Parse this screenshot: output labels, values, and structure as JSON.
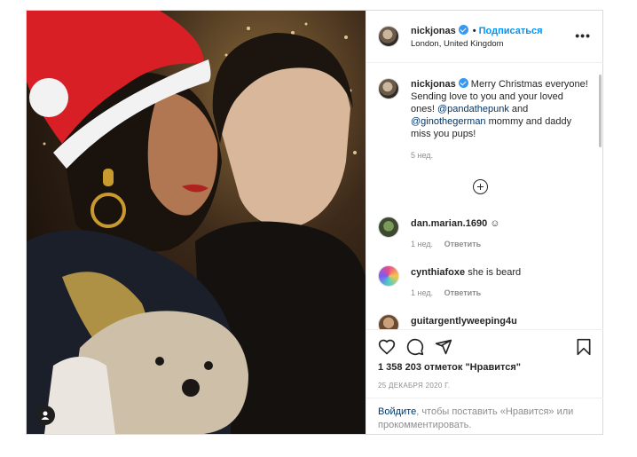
{
  "post": {
    "username": "nickjonas",
    "separator": "•",
    "follow_label": "Подписаться",
    "location": "London, United Kingdom",
    "more_label": "•••"
  },
  "caption": {
    "username": "nickjonas",
    "text_before": " Merry Christmas everyone! Sending love to you and your loved ones! ",
    "mention1": "@pandathepunk",
    "text_mid": " and ",
    "mention2": "@ginothegerman",
    "text_after": " mommy and daddy miss you pups!",
    "time": "5 нед."
  },
  "comments": [
    {
      "username": "dan.marian.1690",
      "text": "☺",
      "time": "1 нед.",
      "reply": "Ответить"
    },
    {
      "username": "cynthiafoxe",
      "text": "she is beard",
      "time": "1 нед.",
      "reply": "Ответить"
    },
    {
      "username": "guitargentlyweeping4u",
      "text": "",
      "time": "",
      "reply": ""
    }
  ],
  "stats": {
    "likes": "1 358 203 отметок \"Нравится\"",
    "date": "25 ДЕКАБРЯ 2020 Г."
  },
  "login_prompt": {
    "link": "Войдите",
    "text": ", чтобы поставить «Нравится» или прокомментировать."
  },
  "icons": [
    "heart-icon",
    "comment-icon",
    "share-icon",
    "bookmark-icon",
    "plus-circle-icon",
    "user-tag-icon",
    "verified-badge-icon"
  ],
  "colors": {
    "link": "#0095f6",
    "mention": "#00376b",
    "muted": "#8e8e8e",
    "verified": "#3897f0"
  }
}
